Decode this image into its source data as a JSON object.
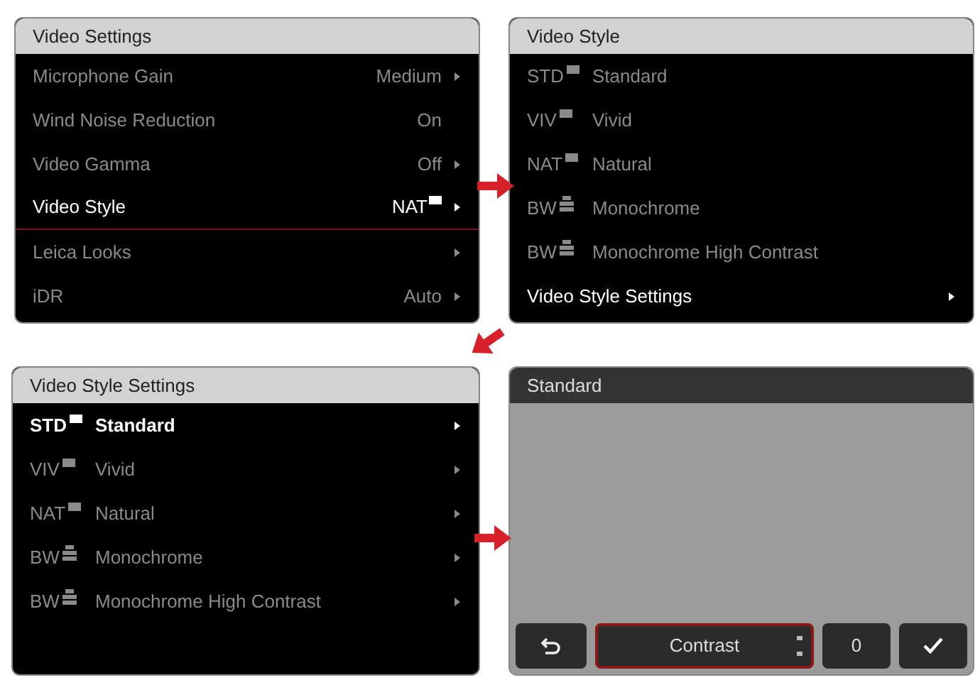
{
  "video_settings": {
    "title": "Video Settings",
    "items": [
      {
        "kind": "text",
        "label": "Microphone Gain",
        "value": "Medium",
        "has_arrow": true,
        "selected": false
      },
      {
        "kind": "text",
        "label": "Wind Noise Reduction",
        "value": "On",
        "has_arrow": false,
        "selected": false
      },
      {
        "kind": "text",
        "label": "Video Gamma",
        "value": "Off",
        "has_arrow": true,
        "selected": false
      },
      {
        "kind": "style",
        "label": "Video Style",
        "value": "NAT",
        "has_arrow": true,
        "selected": true
      },
      {
        "kind": "text",
        "label": "Leica Looks",
        "has_arrow": true,
        "selected": false
      },
      {
        "kind": "text",
        "label": "iDR",
        "value": "Auto",
        "has_arrow": true,
        "selected": false
      }
    ]
  },
  "video_style": {
    "title": "Video Style",
    "items": [
      {
        "code": "STD",
        "kind": "color",
        "label": "Standard"
      },
      {
        "code": "VIV",
        "kind": "color",
        "label": "Vivid"
      },
      {
        "code": "NAT",
        "kind": "color",
        "label": "Natural"
      },
      {
        "code": "BW",
        "kind": "mono",
        "label": "Monochrome"
      },
      {
        "code": "BW",
        "kind": "mono",
        "label": "Monochrome High Contrast"
      }
    ],
    "footer": {
      "label": "Video Style Settings"
    }
  },
  "video_style_settings": {
    "title": "Video Style Settings",
    "items": [
      {
        "code": "STD",
        "kind": "color",
        "label": "Standard",
        "selected": true
      },
      {
        "code": "VIV",
        "kind": "color",
        "label": "Vivid",
        "selected": false
      },
      {
        "code": "NAT",
        "kind": "color",
        "label": "Natural",
        "selected": false
      },
      {
        "code": "BW",
        "kind": "mono",
        "label": "Monochrome",
        "selected": false
      },
      {
        "code": "BW",
        "kind": "mono",
        "label": "Monochrome High Contrast",
        "selected": false
      }
    ]
  },
  "standard_screen": {
    "title": "Standard",
    "buttons": [
      {
        "kind": "back",
        "selected": false
      },
      {
        "kind": "spinner",
        "label": "Contrast",
        "selected": true
      },
      {
        "kind": "value",
        "label": "0",
        "selected": false
      },
      {
        "kind": "confirm",
        "selected": false
      }
    ]
  }
}
